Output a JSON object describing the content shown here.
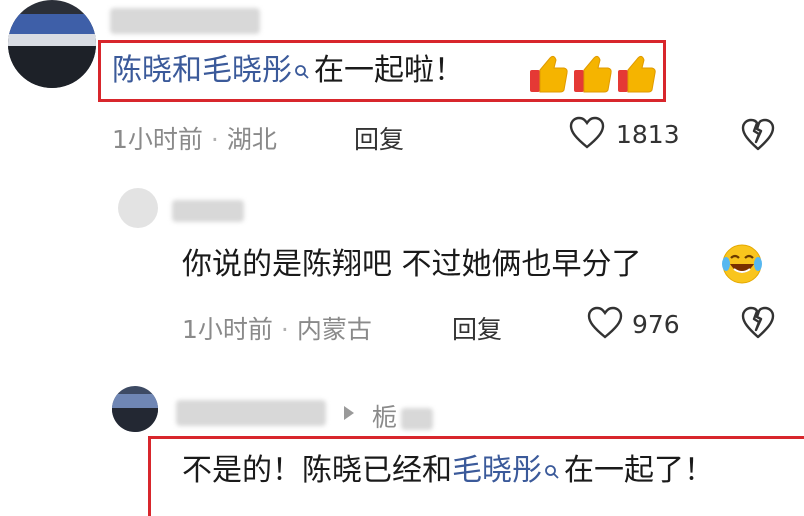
{
  "comment1": {
    "text_link": "陈晓和毛晓彤",
    "text_rest": "在一起啦！",
    "time": "1小时前",
    "location": "湖北",
    "reply_label": "回复",
    "like_count": "1813",
    "emoji": [
      "thumbs-up",
      "thumbs-up",
      "thumbs-up"
    ]
  },
  "reply1": {
    "text": "你说的是陈翔吧 不过她俩也早分了",
    "emoji": "laughing-tears",
    "time": "1小时前",
    "location": "内蒙古",
    "reply_label": "回复",
    "like_count": "976"
  },
  "reply2": {
    "reply_to": "栀",
    "text_before": "不是的！陈晓已经和",
    "text_link": "毛晓彤",
    "text_after": "在一起了！"
  },
  "colors": {
    "highlight_box": "#d8262c",
    "link": "#3b5a9a",
    "meta": "#8a8a8a"
  }
}
